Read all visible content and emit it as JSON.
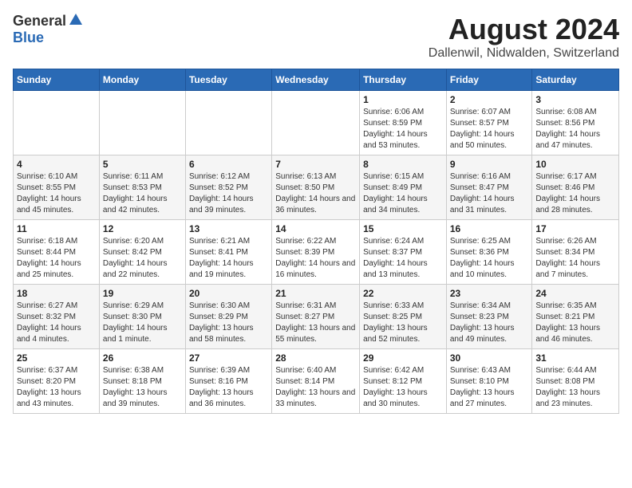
{
  "header": {
    "logo_general": "General",
    "logo_blue": "Blue",
    "month_title": "August 2024",
    "location": "Dallenwil, Nidwalden, Switzerland"
  },
  "days_of_week": [
    "Sunday",
    "Monday",
    "Tuesday",
    "Wednesday",
    "Thursday",
    "Friday",
    "Saturday"
  ],
  "weeks": [
    [
      {
        "day": "",
        "info": ""
      },
      {
        "day": "",
        "info": ""
      },
      {
        "day": "",
        "info": ""
      },
      {
        "day": "",
        "info": ""
      },
      {
        "day": "1",
        "info": "Sunrise: 6:06 AM\nSunset: 8:59 PM\nDaylight: 14 hours and 53 minutes."
      },
      {
        "day": "2",
        "info": "Sunrise: 6:07 AM\nSunset: 8:57 PM\nDaylight: 14 hours and 50 minutes."
      },
      {
        "day": "3",
        "info": "Sunrise: 6:08 AM\nSunset: 8:56 PM\nDaylight: 14 hours and 47 minutes."
      }
    ],
    [
      {
        "day": "4",
        "info": "Sunrise: 6:10 AM\nSunset: 8:55 PM\nDaylight: 14 hours and 45 minutes."
      },
      {
        "day": "5",
        "info": "Sunrise: 6:11 AM\nSunset: 8:53 PM\nDaylight: 14 hours and 42 minutes."
      },
      {
        "day": "6",
        "info": "Sunrise: 6:12 AM\nSunset: 8:52 PM\nDaylight: 14 hours and 39 minutes."
      },
      {
        "day": "7",
        "info": "Sunrise: 6:13 AM\nSunset: 8:50 PM\nDaylight: 14 hours and 36 minutes."
      },
      {
        "day": "8",
        "info": "Sunrise: 6:15 AM\nSunset: 8:49 PM\nDaylight: 14 hours and 34 minutes."
      },
      {
        "day": "9",
        "info": "Sunrise: 6:16 AM\nSunset: 8:47 PM\nDaylight: 14 hours and 31 minutes."
      },
      {
        "day": "10",
        "info": "Sunrise: 6:17 AM\nSunset: 8:46 PM\nDaylight: 14 hours and 28 minutes."
      }
    ],
    [
      {
        "day": "11",
        "info": "Sunrise: 6:18 AM\nSunset: 8:44 PM\nDaylight: 14 hours and 25 minutes."
      },
      {
        "day": "12",
        "info": "Sunrise: 6:20 AM\nSunset: 8:42 PM\nDaylight: 14 hours and 22 minutes."
      },
      {
        "day": "13",
        "info": "Sunrise: 6:21 AM\nSunset: 8:41 PM\nDaylight: 14 hours and 19 minutes."
      },
      {
        "day": "14",
        "info": "Sunrise: 6:22 AM\nSunset: 8:39 PM\nDaylight: 14 hours and 16 minutes."
      },
      {
        "day": "15",
        "info": "Sunrise: 6:24 AM\nSunset: 8:37 PM\nDaylight: 14 hours and 13 minutes."
      },
      {
        "day": "16",
        "info": "Sunrise: 6:25 AM\nSunset: 8:36 PM\nDaylight: 14 hours and 10 minutes."
      },
      {
        "day": "17",
        "info": "Sunrise: 6:26 AM\nSunset: 8:34 PM\nDaylight: 14 hours and 7 minutes."
      }
    ],
    [
      {
        "day": "18",
        "info": "Sunrise: 6:27 AM\nSunset: 8:32 PM\nDaylight: 14 hours and 4 minutes."
      },
      {
        "day": "19",
        "info": "Sunrise: 6:29 AM\nSunset: 8:30 PM\nDaylight: 14 hours and 1 minute."
      },
      {
        "day": "20",
        "info": "Sunrise: 6:30 AM\nSunset: 8:29 PM\nDaylight: 13 hours and 58 minutes."
      },
      {
        "day": "21",
        "info": "Sunrise: 6:31 AM\nSunset: 8:27 PM\nDaylight: 13 hours and 55 minutes."
      },
      {
        "day": "22",
        "info": "Sunrise: 6:33 AM\nSunset: 8:25 PM\nDaylight: 13 hours and 52 minutes."
      },
      {
        "day": "23",
        "info": "Sunrise: 6:34 AM\nSunset: 8:23 PM\nDaylight: 13 hours and 49 minutes."
      },
      {
        "day": "24",
        "info": "Sunrise: 6:35 AM\nSunset: 8:21 PM\nDaylight: 13 hours and 46 minutes."
      }
    ],
    [
      {
        "day": "25",
        "info": "Sunrise: 6:37 AM\nSunset: 8:20 PM\nDaylight: 13 hours and 43 minutes."
      },
      {
        "day": "26",
        "info": "Sunrise: 6:38 AM\nSunset: 8:18 PM\nDaylight: 13 hours and 39 minutes."
      },
      {
        "day": "27",
        "info": "Sunrise: 6:39 AM\nSunset: 8:16 PM\nDaylight: 13 hours and 36 minutes."
      },
      {
        "day": "28",
        "info": "Sunrise: 6:40 AM\nSunset: 8:14 PM\nDaylight: 13 hours and 33 minutes."
      },
      {
        "day": "29",
        "info": "Sunrise: 6:42 AM\nSunset: 8:12 PM\nDaylight: 13 hours and 30 minutes."
      },
      {
        "day": "30",
        "info": "Sunrise: 6:43 AM\nSunset: 8:10 PM\nDaylight: 13 hours and 27 minutes."
      },
      {
        "day": "31",
        "info": "Sunrise: 6:44 AM\nSunset: 8:08 PM\nDaylight: 13 hours and 23 minutes."
      }
    ]
  ]
}
